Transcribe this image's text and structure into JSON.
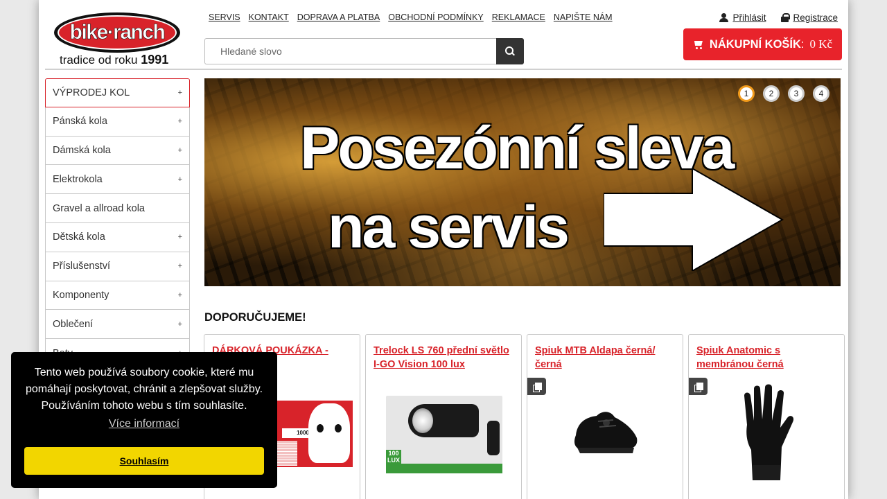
{
  "logo": {
    "brand": "bike·ranch",
    "tagline_prefix": "tradice od roku",
    "tagline_year": "1991"
  },
  "topnav": [
    "SERVIS",
    "KONTAKT",
    "DOPRAVA A PLATBA",
    "OBCHODNÍ PODMÍNKY",
    "REKLAMACE",
    "NAPIŠTE NÁM"
  ],
  "account": {
    "login": "Přihlásit",
    "register": "Registrace"
  },
  "search": {
    "placeholder": "Hledané slovo",
    "value": ""
  },
  "cart": {
    "label": "NÁKUPNÍ KOŠÍK",
    "separator": ":",
    "amount": "0 Kč"
  },
  "sidebar": {
    "items": [
      {
        "label": "VÝPRODEJ KOL",
        "expand": "+"
      },
      {
        "label": "Pánská kola",
        "expand": "+"
      },
      {
        "label": "Dámská kola",
        "expand": "+"
      },
      {
        "label": "Elektrokola",
        "expand": "+"
      },
      {
        "label": "Gravel a allroad kola",
        "expand": ""
      },
      {
        "label": "Dětská kola",
        "expand": "+"
      },
      {
        "label": "Příslušenství",
        "expand": "+"
      },
      {
        "label": "Komponenty",
        "expand": "+"
      },
      {
        "label": "Oblečení",
        "expand": "+"
      },
      {
        "label": "Boty",
        "expand": "+"
      }
    ]
  },
  "banner": {
    "line1": "Posezónní sleva",
    "line2": "na servis",
    "slides": [
      "1",
      "2",
      "3",
      "4"
    ],
    "active_slide": 1
  },
  "recommended": {
    "title": "DOPORUČUJEME!",
    "products": [
      {
        "title": "DÁRKOVÁ POUKÁZKA -",
        "image_text": "1000"
      },
      {
        "title": "Trelock LS 760 přední světlo I-GO Vision 100 lux",
        "image_text": "100 LUX"
      },
      {
        "title": "Spiuk MTB Aldapa černá/ černá"
      },
      {
        "title": "Spiuk Anatomic s membránou černá"
      }
    ]
  },
  "cookie": {
    "text": "Tento web používá soubory cookie, které mu pomáhají poskytovat, chránit a zlepšovat služby. Používáním tohoto webu s tím souhlasíte.",
    "more": "Více informací",
    "accept": "Souhlasím"
  },
  "colors": {
    "brand_red": "#e8232b",
    "accept_yellow": "#f2d600",
    "slider_active": "#f19a1b"
  },
  "icons": {
    "login": "user-icon",
    "register": "lock-icon",
    "search": "search-icon",
    "cart": "cart-icon",
    "badge": "compare-icon"
  }
}
